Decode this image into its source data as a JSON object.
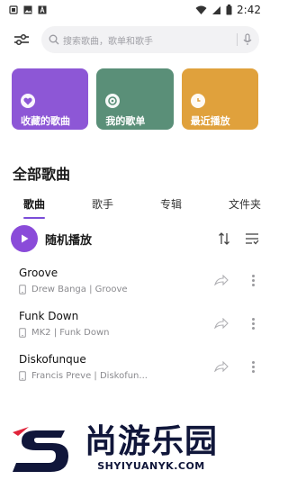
{
  "status_bar": {
    "time": "2:42"
  },
  "search": {
    "placeholder": "搜索歌曲，歌单和歌手"
  },
  "tiles": [
    {
      "label": "收藏的歌曲",
      "color": "#8d57d6",
      "icon": "heart-icon"
    },
    {
      "label": "我的歌单",
      "color": "#5a8f78",
      "icon": "disc-icon"
    },
    {
      "label": "最近播放",
      "color": "#e0a13c",
      "icon": "clock-icon"
    }
  ],
  "library": {
    "title": "全部歌曲",
    "tabs": [
      {
        "label": "歌曲",
        "active": true
      },
      {
        "label": "歌手",
        "active": false
      },
      {
        "label": "专辑",
        "active": false
      },
      {
        "label": "文件夹",
        "active": false
      }
    ],
    "shuffle_label": "随机播放"
  },
  "songs": [
    {
      "title": "Groove",
      "subtitle": "Drew Banga | Groove"
    },
    {
      "title": "Funk Down",
      "subtitle": "MK2 | Funk Down"
    },
    {
      "title": "Diskofunque",
      "subtitle": "Francis Preve | Diskofun..."
    }
  ],
  "watermark": {
    "text": "尚游乐园",
    "url": "SHYIYUANYK.COM"
  },
  "colors": {
    "accent": "#8a4bd9",
    "watermark": "#10163a",
    "watermark_red": "#e0233a"
  }
}
